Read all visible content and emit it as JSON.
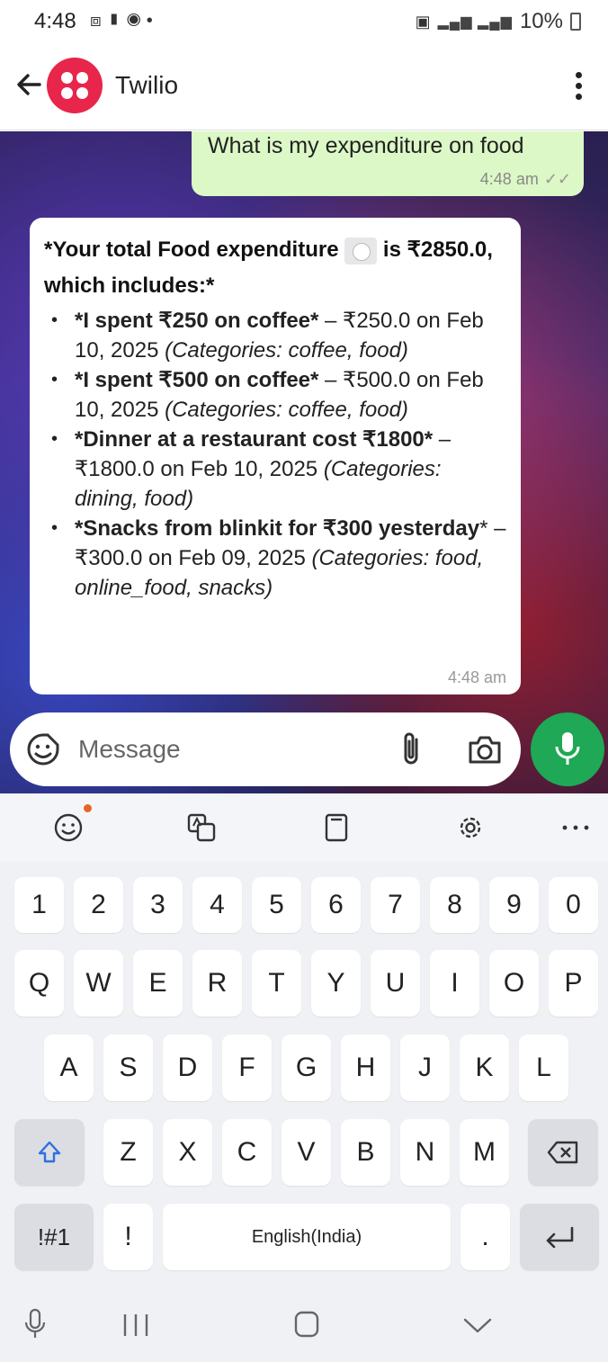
{
  "status_bar": {
    "time": "4:48",
    "left_icons": [
      "screenshot-icon",
      "battery-saver-icon",
      "messenger-icon",
      "dot"
    ],
    "right_icons": [
      "alarm-icon",
      "signal-icon",
      "volte-icon",
      "4g-icon",
      "signal-icon"
    ],
    "battery_percent": "10%"
  },
  "app_bar": {
    "title": "Twilio"
  },
  "chat": {
    "outgoing": {
      "text": "What is my expenditure on food",
      "time": "4:48 am",
      "ticks": "✓✓"
    },
    "incoming": {
      "heading_pre": "*Your total Food expenditure",
      "heading_post": "is ₹2850.0, which includes:*",
      "items": [
        {
          "bold": "*I spent ₹250 on coffee*",
          "rest": " – ₹250.0 on Feb 10, 2025 ",
          "italic": "(Categories: coffee, food)"
        },
        {
          "bold": "*I spent ₹500 on coffee*",
          "rest": " – ₹500.0 on Feb 10, 2025 ",
          "italic": "(Categories: coffee, food)"
        },
        {
          "bold": "*Dinner at a restaurant cost ₹1800*",
          "rest": " – ₹1800.0 on Feb 10, 2025 ",
          "italic": "(Categories: dining, food)"
        },
        {
          "bold": "*Snacks from blinkit for ₹300 yesterday",
          "rest": "* – ₹300.0 on Feb 09, 2025 ",
          "italic": "(Categories: food, online_food, snacks)"
        }
      ],
      "time": "4:48 am"
    }
  },
  "input": {
    "placeholder": "Message"
  },
  "keyboard": {
    "toolbar": [
      "emoji-icon",
      "translate-icon",
      "clipboard-icon",
      "settings-icon",
      "more-icon"
    ],
    "row_numbers": [
      "1",
      "2",
      "3",
      "4",
      "5",
      "6",
      "7",
      "8",
      "9",
      "0"
    ],
    "row_1": [
      "Q",
      "W",
      "E",
      "R",
      "T",
      "Y",
      "U",
      "I",
      "O",
      "P"
    ],
    "row_2": [
      "A",
      "S",
      "D",
      "F",
      "G",
      "H",
      "J",
      "K",
      "L"
    ],
    "row_3": [
      "Z",
      "X",
      "C",
      "V",
      "B",
      "N",
      "M"
    ],
    "symbols_key": "!#1",
    "exclaim_key": "!",
    "space_label": "English(India)",
    "period_key": "."
  },
  "colors": {
    "accent_green": "#1fa855",
    "outgoing_bubble": "#dcf8c6",
    "twilio_red": "#e8254a"
  }
}
